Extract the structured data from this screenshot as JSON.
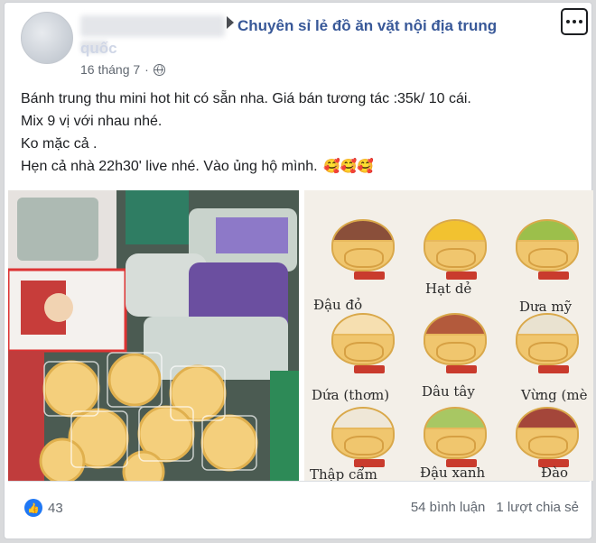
{
  "post": {
    "group_name": "Chuyên sỉ lẻ đồ ăn vặt nội địa trung",
    "group_name_cont": "quốc",
    "date": "16 tháng 7",
    "dot": "·",
    "lines": [
      "Bánh trung thu mini hot hit có sẵn nha. Giá bán tương tác :35k/ 10 cái.",
      "Mix 9 vị với nhau nhé.",
      "Ko mặc cả .",
      "Hẹn cả nhà 22h30' live nhé. Vào ủng hộ mình."
    ],
    "emoji": "🥰🥰🥰"
  },
  "image_right": {
    "flavors": [
      "Đậu đỏ",
      "Hạt dẻ",
      "Dưa mỹ",
      "Dứa (thơm)",
      "Dâu tây",
      "Vừng (mè",
      "Thập cẩm",
      "Đậu xanh",
      "Đào"
    ],
    "filling_colors": [
      "#8a4f3a",
      "#f2c230",
      "#9cbf4b",
      "#f6dfb0",
      "#b35a3c",
      "#e9e2d0",
      "#efe7d7",
      "#a8c763",
      "#a4463a"
    ]
  },
  "footer": {
    "like_count": "43",
    "comments": "54 bình luận",
    "shares": "1 lượt chia sẻ"
  },
  "colors": {
    "link": "#385898",
    "like": "#2078f4",
    "muted": "#606770"
  },
  "icons": {
    "options": "more-options-icon",
    "privacy": "globe-icon",
    "like": "thumbs-up-icon"
  }
}
